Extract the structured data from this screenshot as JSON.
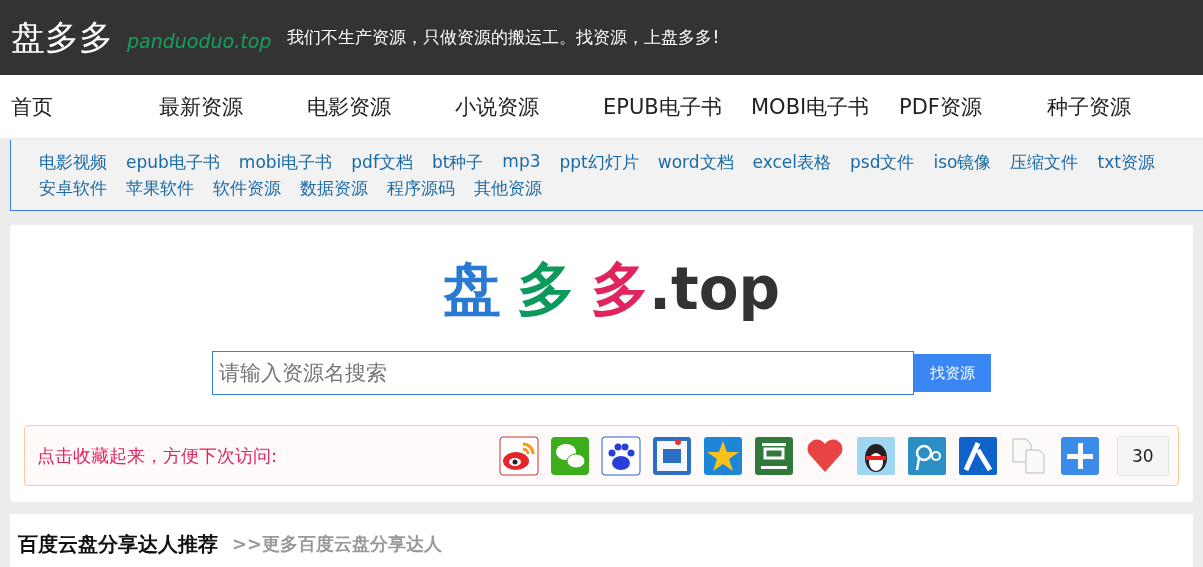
{
  "header": {
    "site_name": "盘多多",
    "domain": "panduoduo.top",
    "slogan": "我们不生产资源，只做资源的搬运工。找资源，上盘多多!"
  },
  "nav": [
    "首页",
    "最新资源",
    "电影资源",
    "小说资源",
    "EPUB电子书",
    "MOBI电子书",
    "PDF资源",
    "种子资源"
  ],
  "categories": [
    "电影视频",
    "epub电子书",
    "mobi电子书",
    "pdf文档",
    "bt种子",
    "mp3",
    "ppt幻灯片",
    "word文档",
    "excel表格",
    "psd文件",
    "iso镜像",
    "压缩文件",
    "txt资源",
    "安卓软件",
    "苹果软件",
    "软件资源",
    "数据资源",
    "程序源码",
    "其他资源"
  ],
  "logo": {
    "chars": [
      {
        "text": "盘",
        "color": "#2a7ad2"
      },
      {
        "text": "多",
        "color": "#0b9a5c"
      },
      {
        "text": "多",
        "color": "#e0245e"
      }
    ],
    "suffix": ".top"
  },
  "search": {
    "placeholder": "请输入资源名搜索",
    "button": "找资源"
  },
  "share": {
    "label": "点击收藏起来，方便下次访问:",
    "count": "30"
  },
  "section": {
    "title": "百度云盘分享达人推荐",
    "more": ">>更多百度云盘分享达人"
  }
}
